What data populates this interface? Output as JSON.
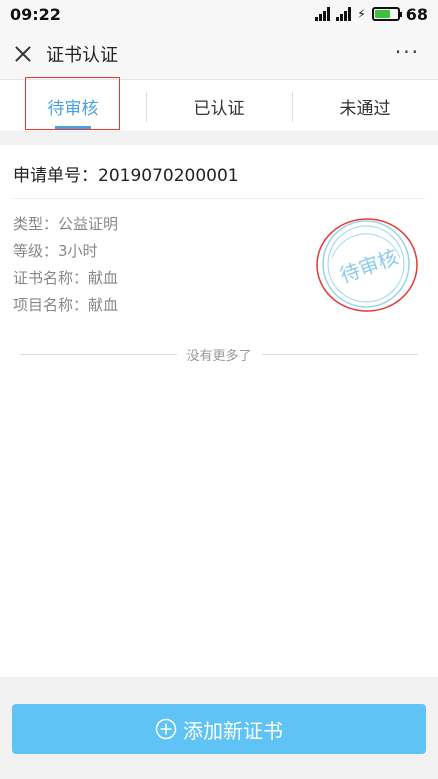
{
  "status": {
    "time": "09:22",
    "battery": "68",
    "net1": "3G",
    "net2": "4G"
  },
  "nav": {
    "title": "证书认证",
    "more": "···"
  },
  "tabs": [
    {
      "label": "待审核",
      "active": true
    },
    {
      "label": "已认证",
      "active": false
    },
    {
      "label": "未通过",
      "active": false
    }
  ],
  "card": {
    "order_label": "申请单号：",
    "order_no": "2019070200001",
    "type": "类型：公益证明",
    "level": "等级：3小时",
    "cert_name": "证书名称：献血",
    "project_name": "项目名称：献血",
    "stamp_text": "待审核"
  },
  "list_end": "没有更多了",
  "add_button": "添加新证书",
  "colors": {
    "accent": "#4aa3df",
    "button": "#5fc3f5",
    "annotation": "#e53935"
  }
}
